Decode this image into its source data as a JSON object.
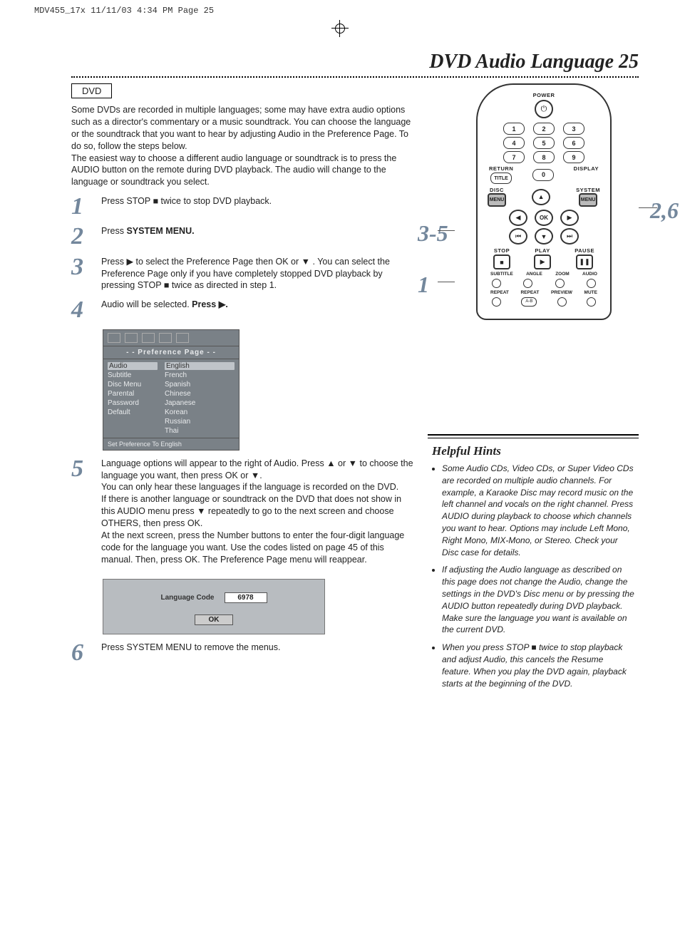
{
  "print_header": "MDV455_17x  11/11/03  4:34 PM  Page 25",
  "page_title": "DVD Audio Language  25",
  "dvd_tag": "DVD",
  "intro": "Some DVDs are recorded in multiple languages; some may have extra audio options such as a director's commentary or a music soundtrack. You can choose the language or the soundtrack that you want to hear by adjusting Audio in the Preference Page.  To do so, follow the steps below.\nThe easiest way to choose a different audio language or soundtrack is to press the AUDIO button on the remote during DVD playback. The audio will change to the language or soundtrack you select.",
  "steps": {
    "s1": {
      "num": "1",
      "text_a": "Press STOP ",
      "sym": "■",
      "text_b": " twice to stop DVD playback."
    },
    "s2": {
      "num": "2",
      "text_a": "Press ",
      "bold": "SYSTEM MENU."
    },
    "s3": {
      "num": "3",
      "text_a": "Press ",
      "sym1": "▶",
      "text_b": " to select the Preference Page then OK or ",
      "sym2": "▼",
      "text_c": " .  You can select the Preference Page only if you have completely stopped DVD playback by pressing STOP ",
      "sym3": "■",
      "text_d": " twice as directed in step 1."
    },
    "s4": {
      "num": "4",
      "text_a": "Audio will be selected. ",
      "bold": "Press ",
      "sym": "▶",
      "bold2": "."
    },
    "s5": {
      "num": "5",
      "line1_a": "Language options will appear to the right of Audio. Press ",
      "u": "▲",
      "or": " or ",
      "d": "▼",
      "line1_b": " to choose the language you want, then press OK or ",
      "d2": "▼",
      "dot": ".",
      "line2": "You can only hear these languages if the language is recorded on the DVD.",
      "line3_a": "If there is another language or soundtrack on the DVD that does not show in this AUDIO menu press ",
      "d3": "▼",
      "line3_b": " repeatedly to go to the next screen and choose OTHERS, then press OK.",
      "line4": "At the next screen, press the Number buttons to enter the four-digit language code for the language you want. Use the codes listed on page 45 of this manual. Then, press OK. The Preference Page menu will reappear."
    },
    "s6": {
      "num": "6",
      "text": "Press SYSTEM MENU to remove the menus."
    }
  },
  "pref": {
    "title": "- -  Preference Page  - -",
    "left": [
      "Audio",
      "Subtitle",
      "Disc Menu",
      "Parental",
      "Password",
      "Default"
    ],
    "right": [
      "English",
      "French",
      "Spanish",
      "Chinese",
      "Japanese",
      "Korean",
      "Russian",
      "Thai"
    ],
    "footer": "Set Preference To English"
  },
  "code_panel": {
    "label": "Language Code",
    "value": "6978",
    "ok": "OK"
  },
  "remote": {
    "power": "POWER",
    "numbers": [
      "1",
      "2",
      "3",
      "4",
      "5",
      "6",
      "7",
      "8",
      "9",
      "0"
    ],
    "return": "RETURN",
    "display": "DISPLAY",
    "title": "TITLE",
    "disc": "DISC",
    "system": "SYSTEM",
    "menu": "MENU",
    "ok": "OK",
    "stop": "STOP",
    "play": "PLAY",
    "pause": "PAUSE",
    "row_labels": [
      "SUBTITLE",
      "ANGLE",
      "ZOOM",
      "AUDIO"
    ],
    "row2_labels": [
      "REPEAT",
      "REPEAT",
      "PREVIEW",
      "MUTE"
    ],
    "ab": "A-B"
  },
  "callouts": {
    "left_top": "3-5",
    "left_bottom": "1",
    "right": "2,6"
  },
  "hints": {
    "title": "Helpful Hints",
    "items": [
      "Some Audio CDs, Video CDs, or Super Video CDs are recorded on multiple audio channels. For example, a Karaoke Disc may record music on the left channel and vocals on the right channel. Press AUDIO during playback to choose which channels you want to hear. Options may include Left Mono, Right Mono, MIX-Mono, or Stereo. Check your Disc case for details.",
      "If adjusting the Audio language as described on this page does not change the Audio, change the settings in the DVD's Disc menu or by pressing the AUDIO button repeatedly during DVD playback. Make sure the language you want is available on the current DVD.",
      "When you press STOP ■ twice to stop playback and adjust Audio, this cancels the Resume feature. When you play the DVD again, playback starts at the beginning of the DVD."
    ]
  }
}
